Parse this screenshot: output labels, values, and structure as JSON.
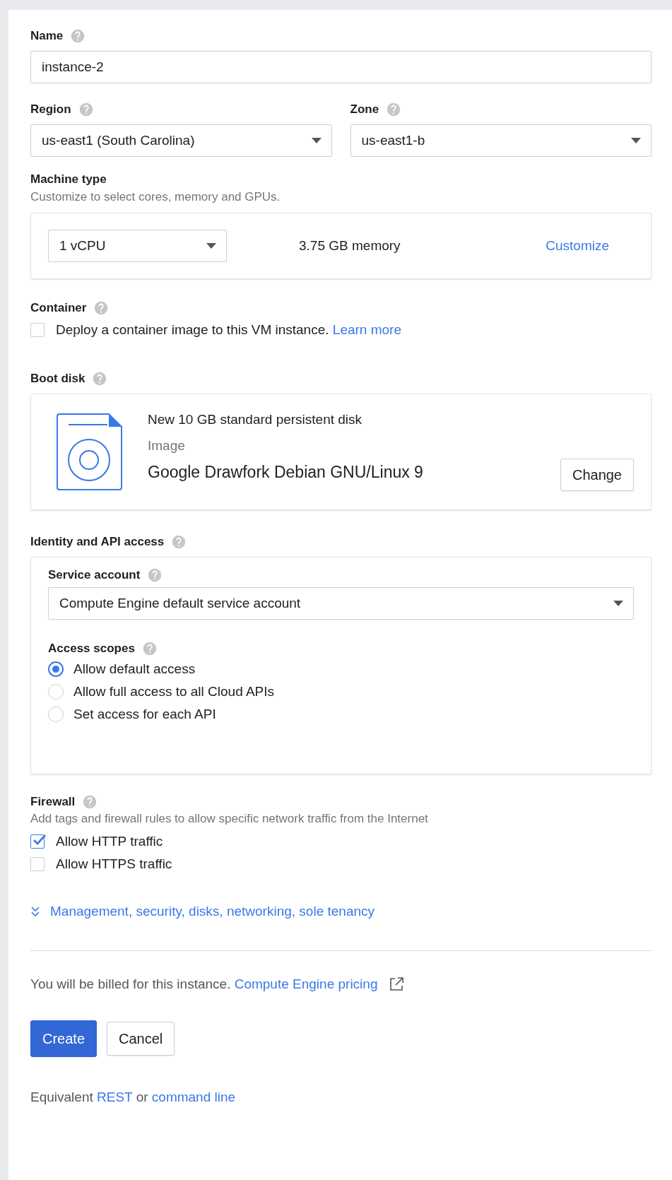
{
  "name": {
    "label": "Name",
    "value": "instance-2"
  },
  "region": {
    "label": "Region",
    "value": "us-east1 (South Carolina)"
  },
  "zone": {
    "label": "Zone",
    "value": "us-east1-b"
  },
  "machine_type": {
    "label": "Machine type",
    "description": "Customize to select cores, memory and GPUs.",
    "cpu": "1 vCPU",
    "memory": "3.75 GB memory",
    "customize": "Customize"
  },
  "container": {
    "label": "Container",
    "checked": false,
    "text": "Deploy a container image to this VM instance.",
    "link": "Learn more"
  },
  "boot_disk": {
    "label": "Boot disk",
    "title": "New 10 GB standard persistent disk",
    "image_label": "Image",
    "image": "Google Drawfork Debian GNU/Linux 9",
    "button": "Change"
  },
  "identity": {
    "label": "Identity and API access",
    "service_account": {
      "label": "Service account",
      "value": "Compute Engine default service account"
    },
    "access_scopes": {
      "label": "Access scopes",
      "options": [
        {
          "label": "Allow default access",
          "selected": true
        },
        {
          "label": "Allow full access to all Cloud APIs",
          "selected": false
        },
        {
          "label": "Set access for each API",
          "selected": false
        }
      ]
    }
  },
  "firewall": {
    "label": "Firewall",
    "description": "Add tags and firewall rules to allow specific network traffic from the Internet",
    "options": [
      {
        "label": "Allow HTTP traffic",
        "checked": true
      },
      {
        "label": "Allow HTTPS traffic",
        "checked": false
      }
    ]
  },
  "more_options": {
    "label": "Management, security, disks, networking, sole tenancy",
    "expanded": false
  },
  "billing": {
    "text": "You will be billed for this instance.",
    "link": "Compute Engine pricing"
  },
  "buttons": [
    {
      "label": "Create",
      "kind": "primary"
    },
    {
      "label": "Cancel",
      "kind": "secondary"
    }
  ],
  "equivalent": {
    "prefix": "Equivalent",
    "link1": "REST",
    "middle": "or",
    "link2": "command line"
  }
}
